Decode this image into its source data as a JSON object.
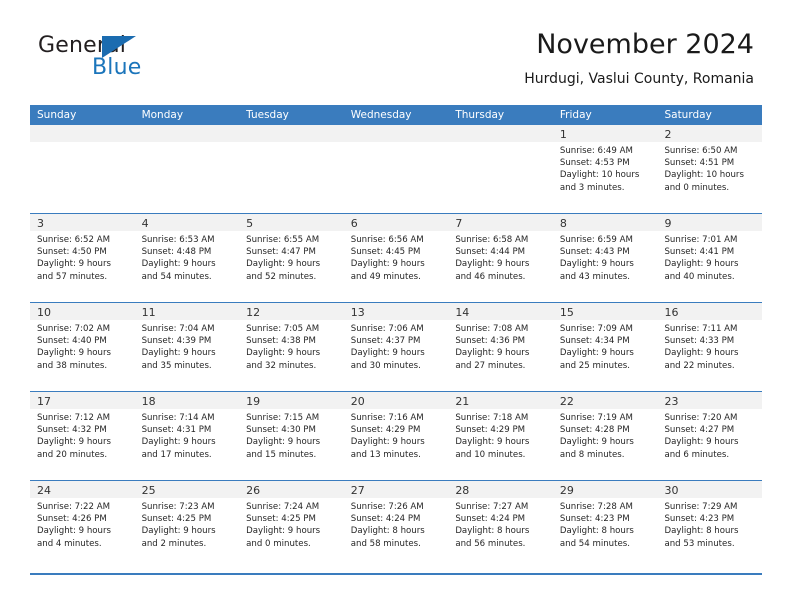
{
  "brand": {
    "name_top": "General",
    "name_bottom": "Blue",
    "triangle_icon": "triangle-icon",
    "accent_color": "#1b75bb"
  },
  "header": {
    "title": "November 2024",
    "subtitle": "Hurdugi, Vaslui County, Romania"
  },
  "theme": {
    "header_blue": "#3a7cbe",
    "day_band_gray": "#f2f2f2",
    "text_dark": "#262626"
  },
  "weekdays": [
    "Sunday",
    "Monday",
    "Tuesday",
    "Wednesday",
    "Thursday",
    "Friday",
    "Saturday"
  ],
  "weeks": [
    [
      {
        "day": "",
        "sunrise": "",
        "sunset": "",
        "daylight1": "",
        "daylight2": ""
      },
      {
        "day": "",
        "sunrise": "",
        "sunset": "",
        "daylight1": "",
        "daylight2": ""
      },
      {
        "day": "",
        "sunrise": "",
        "sunset": "",
        "daylight1": "",
        "daylight2": ""
      },
      {
        "day": "",
        "sunrise": "",
        "sunset": "",
        "daylight1": "",
        "daylight2": ""
      },
      {
        "day": "",
        "sunrise": "",
        "sunset": "",
        "daylight1": "",
        "daylight2": ""
      },
      {
        "day": "1",
        "sunrise": "Sunrise: 6:49 AM",
        "sunset": "Sunset: 4:53 PM",
        "daylight1": "Daylight: 10 hours",
        "daylight2": "and 3 minutes."
      },
      {
        "day": "2",
        "sunrise": "Sunrise: 6:50 AM",
        "sunset": "Sunset: 4:51 PM",
        "daylight1": "Daylight: 10 hours",
        "daylight2": "and 0 minutes."
      }
    ],
    [
      {
        "day": "3",
        "sunrise": "Sunrise: 6:52 AM",
        "sunset": "Sunset: 4:50 PM",
        "daylight1": "Daylight: 9 hours",
        "daylight2": "and 57 minutes."
      },
      {
        "day": "4",
        "sunrise": "Sunrise: 6:53 AM",
        "sunset": "Sunset: 4:48 PM",
        "daylight1": "Daylight: 9 hours",
        "daylight2": "and 54 minutes."
      },
      {
        "day": "5",
        "sunrise": "Sunrise: 6:55 AM",
        "sunset": "Sunset: 4:47 PM",
        "daylight1": "Daylight: 9 hours",
        "daylight2": "and 52 minutes."
      },
      {
        "day": "6",
        "sunrise": "Sunrise: 6:56 AM",
        "sunset": "Sunset: 4:45 PM",
        "daylight1": "Daylight: 9 hours",
        "daylight2": "and 49 minutes."
      },
      {
        "day": "7",
        "sunrise": "Sunrise: 6:58 AM",
        "sunset": "Sunset: 4:44 PM",
        "daylight1": "Daylight: 9 hours",
        "daylight2": "and 46 minutes."
      },
      {
        "day": "8",
        "sunrise": "Sunrise: 6:59 AM",
        "sunset": "Sunset: 4:43 PM",
        "daylight1": "Daylight: 9 hours",
        "daylight2": "and 43 minutes."
      },
      {
        "day": "9",
        "sunrise": "Sunrise: 7:01 AM",
        "sunset": "Sunset: 4:41 PM",
        "daylight1": "Daylight: 9 hours",
        "daylight2": "and 40 minutes."
      }
    ],
    [
      {
        "day": "10",
        "sunrise": "Sunrise: 7:02 AM",
        "sunset": "Sunset: 4:40 PM",
        "daylight1": "Daylight: 9 hours",
        "daylight2": "and 38 minutes."
      },
      {
        "day": "11",
        "sunrise": "Sunrise: 7:04 AM",
        "sunset": "Sunset: 4:39 PM",
        "daylight1": "Daylight: 9 hours",
        "daylight2": "and 35 minutes."
      },
      {
        "day": "12",
        "sunrise": "Sunrise: 7:05 AM",
        "sunset": "Sunset: 4:38 PM",
        "daylight1": "Daylight: 9 hours",
        "daylight2": "and 32 minutes."
      },
      {
        "day": "13",
        "sunrise": "Sunrise: 7:06 AM",
        "sunset": "Sunset: 4:37 PM",
        "daylight1": "Daylight: 9 hours",
        "daylight2": "and 30 minutes."
      },
      {
        "day": "14",
        "sunrise": "Sunrise: 7:08 AM",
        "sunset": "Sunset: 4:36 PM",
        "daylight1": "Daylight: 9 hours",
        "daylight2": "and 27 minutes."
      },
      {
        "day": "15",
        "sunrise": "Sunrise: 7:09 AM",
        "sunset": "Sunset: 4:34 PM",
        "daylight1": "Daylight: 9 hours",
        "daylight2": "and 25 minutes."
      },
      {
        "day": "16",
        "sunrise": "Sunrise: 7:11 AM",
        "sunset": "Sunset: 4:33 PM",
        "daylight1": "Daylight: 9 hours",
        "daylight2": "and 22 minutes."
      }
    ],
    [
      {
        "day": "17",
        "sunrise": "Sunrise: 7:12 AM",
        "sunset": "Sunset: 4:32 PM",
        "daylight1": "Daylight: 9 hours",
        "daylight2": "and 20 minutes."
      },
      {
        "day": "18",
        "sunrise": "Sunrise: 7:14 AM",
        "sunset": "Sunset: 4:31 PM",
        "daylight1": "Daylight: 9 hours",
        "daylight2": "and 17 minutes."
      },
      {
        "day": "19",
        "sunrise": "Sunrise: 7:15 AM",
        "sunset": "Sunset: 4:30 PM",
        "daylight1": "Daylight: 9 hours",
        "daylight2": "and 15 minutes."
      },
      {
        "day": "20",
        "sunrise": "Sunrise: 7:16 AM",
        "sunset": "Sunset: 4:29 PM",
        "daylight1": "Daylight: 9 hours",
        "daylight2": "and 13 minutes."
      },
      {
        "day": "21",
        "sunrise": "Sunrise: 7:18 AM",
        "sunset": "Sunset: 4:29 PM",
        "daylight1": "Daylight: 9 hours",
        "daylight2": "and 10 minutes."
      },
      {
        "day": "22",
        "sunrise": "Sunrise: 7:19 AM",
        "sunset": "Sunset: 4:28 PM",
        "daylight1": "Daylight: 9 hours",
        "daylight2": "and 8 minutes."
      },
      {
        "day": "23",
        "sunrise": "Sunrise: 7:20 AM",
        "sunset": "Sunset: 4:27 PM",
        "daylight1": "Daylight: 9 hours",
        "daylight2": "and 6 minutes."
      }
    ],
    [
      {
        "day": "24",
        "sunrise": "Sunrise: 7:22 AM",
        "sunset": "Sunset: 4:26 PM",
        "daylight1": "Daylight: 9 hours",
        "daylight2": "and 4 minutes."
      },
      {
        "day": "25",
        "sunrise": "Sunrise: 7:23 AM",
        "sunset": "Sunset: 4:25 PM",
        "daylight1": "Daylight: 9 hours",
        "daylight2": "and 2 minutes."
      },
      {
        "day": "26",
        "sunrise": "Sunrise: 7:24 AM",
        "sunset": "Sunset: 4:25 PM",
        "daylight1": "Daylight: 9 hours",
        "daylight2": "and 0 minutes."
      },
      {
        "day": "27",
        "sunrise": "Sunrise: 7:26 AM",
        "sunset": "Sunset: 4:24 PM",
        "daylight1": "Daylight: 8 hours",
        "daylight2": "and 58 minutes."
      },
      {
        "day": "28",
        "sunrise": "Sunrise: 7:27 AM",
        "sunset": "Sunset: 4:24 PM",
        "daylight1": "Daylight: 8 hours",
        "daylight2": "and 56 minutes."
      },
      {
        "day": "29",
        "sunrise": "Sunrise: 7:28 AM",
        "sunset": "Sunset: 4:23 PM",
        "daylight1": "Daylight: 8 hours",
        "daylight2": "and 54 minutes."
      },
      {
        "day": "30",
        "sunrise": "Sunrise: 7:29 AM",
        "sunset": "Sunset: 4:23 PM",
        "daylight1": "Daylight: 8 hours",
        "daylight2": "and 53 minutes."
      }
    ]
  ]
}
